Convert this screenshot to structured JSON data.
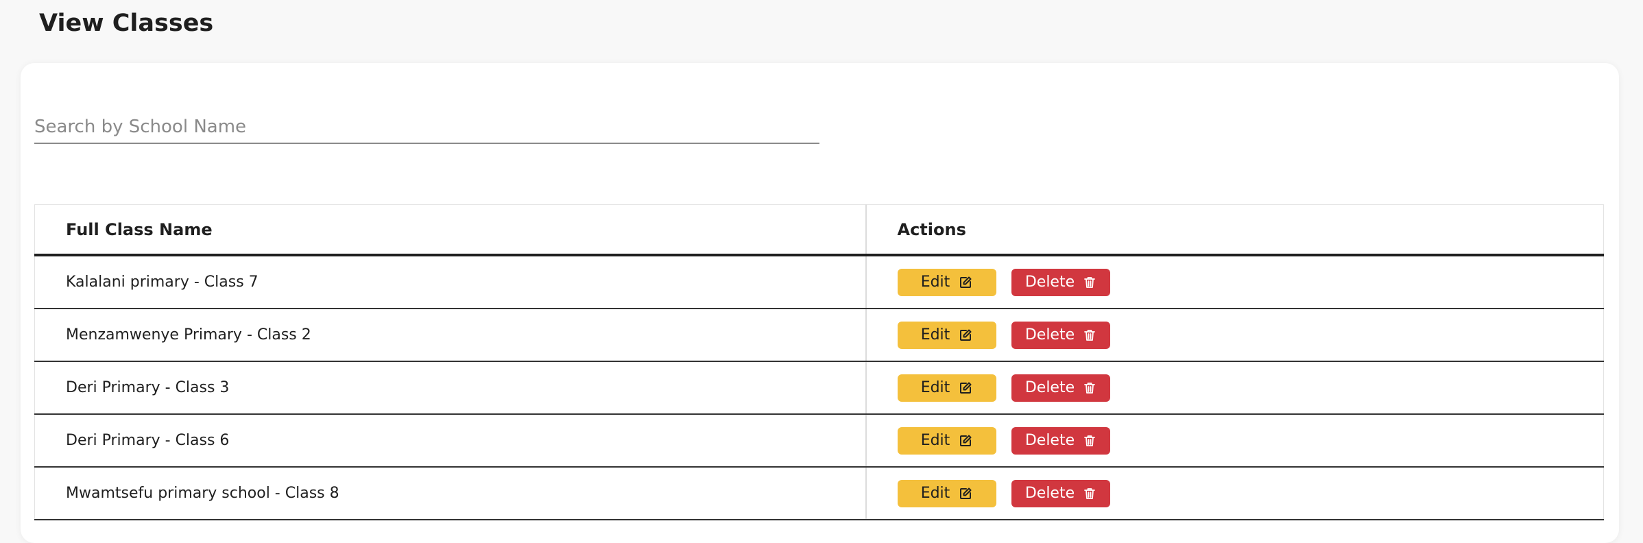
{
  "page": {
    "title": "View Classes"
  },
  "search": {
    "placeholder": "Search by School Name",
    "value": ""
  },
  "table": {
    "headers": {
      "name": "Full Class Name",
      "actions": "Actions"
    },
    "rows": [
      {
        "name": "Kalalani primary - Class 7"
      },
      {
        "name": "Menzamwenye Primary - Class 2"
      },
      {
        "name": "Deri Primary - Class 3"
      },
      {
        "name": "Deri Primary - Class 6"
      },
      {
        "name": "Mwamtsefu primary school - Class 8"
      }
    ]
  },
  "actions": {
    "edit_label": "Edit",
    "delete_label": "Delete",
    "edit_icon": "pencil-square-icon",
    "delete_icon": "trash-icon"
  },
  "colors": {
    "edit_button": "#f4c03c",
    "delete_button": "#d1373f",
    "background": "#f8f8f8"
  }
}
